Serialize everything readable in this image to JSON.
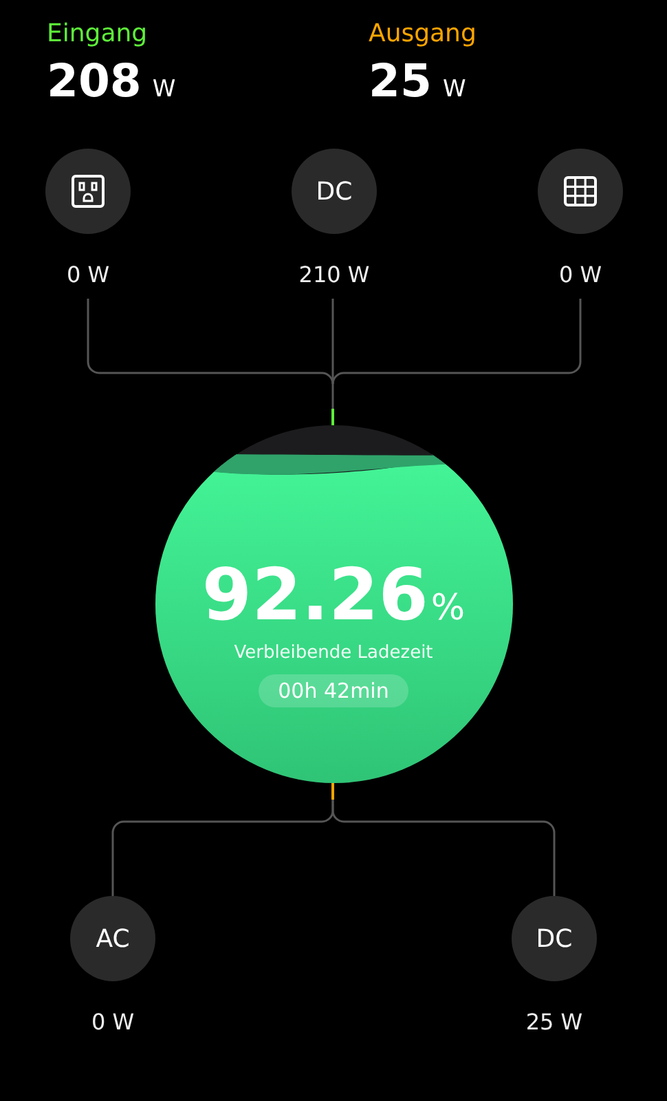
{
  "summary": [
    {
      "kind": "input",
      "label": "Eingang",
      "value": "208",
      "unit": "W"
    },
    {
      "kind": "output",
      "label": "Ausgang",
      "value": "25",
      "unit": "W"
    }
  ],
  "inputs": [
    {
      "kind": "outlet",
      "reading": "0 W"
    },
    {
      "kind": "text",
      "text": "DC",
      "reading": "210 W"
    },
    {
      "kind": "panel",
      "reading": "0 W"
    }
  ],
  "battery": {
    "percent": "92.26",
    "unit": "%",
    "caption": "Verbleibende Ladezeit",
    "time": "00h 42min"
  },
  "outputs": [
    {
      "kind": "text",
      "text": "AC",
      "reading": "0 W"
    },
    {
      "kind": "text",
      "text": "DC",
      "reading": "25 W"
    }
  ]
}
